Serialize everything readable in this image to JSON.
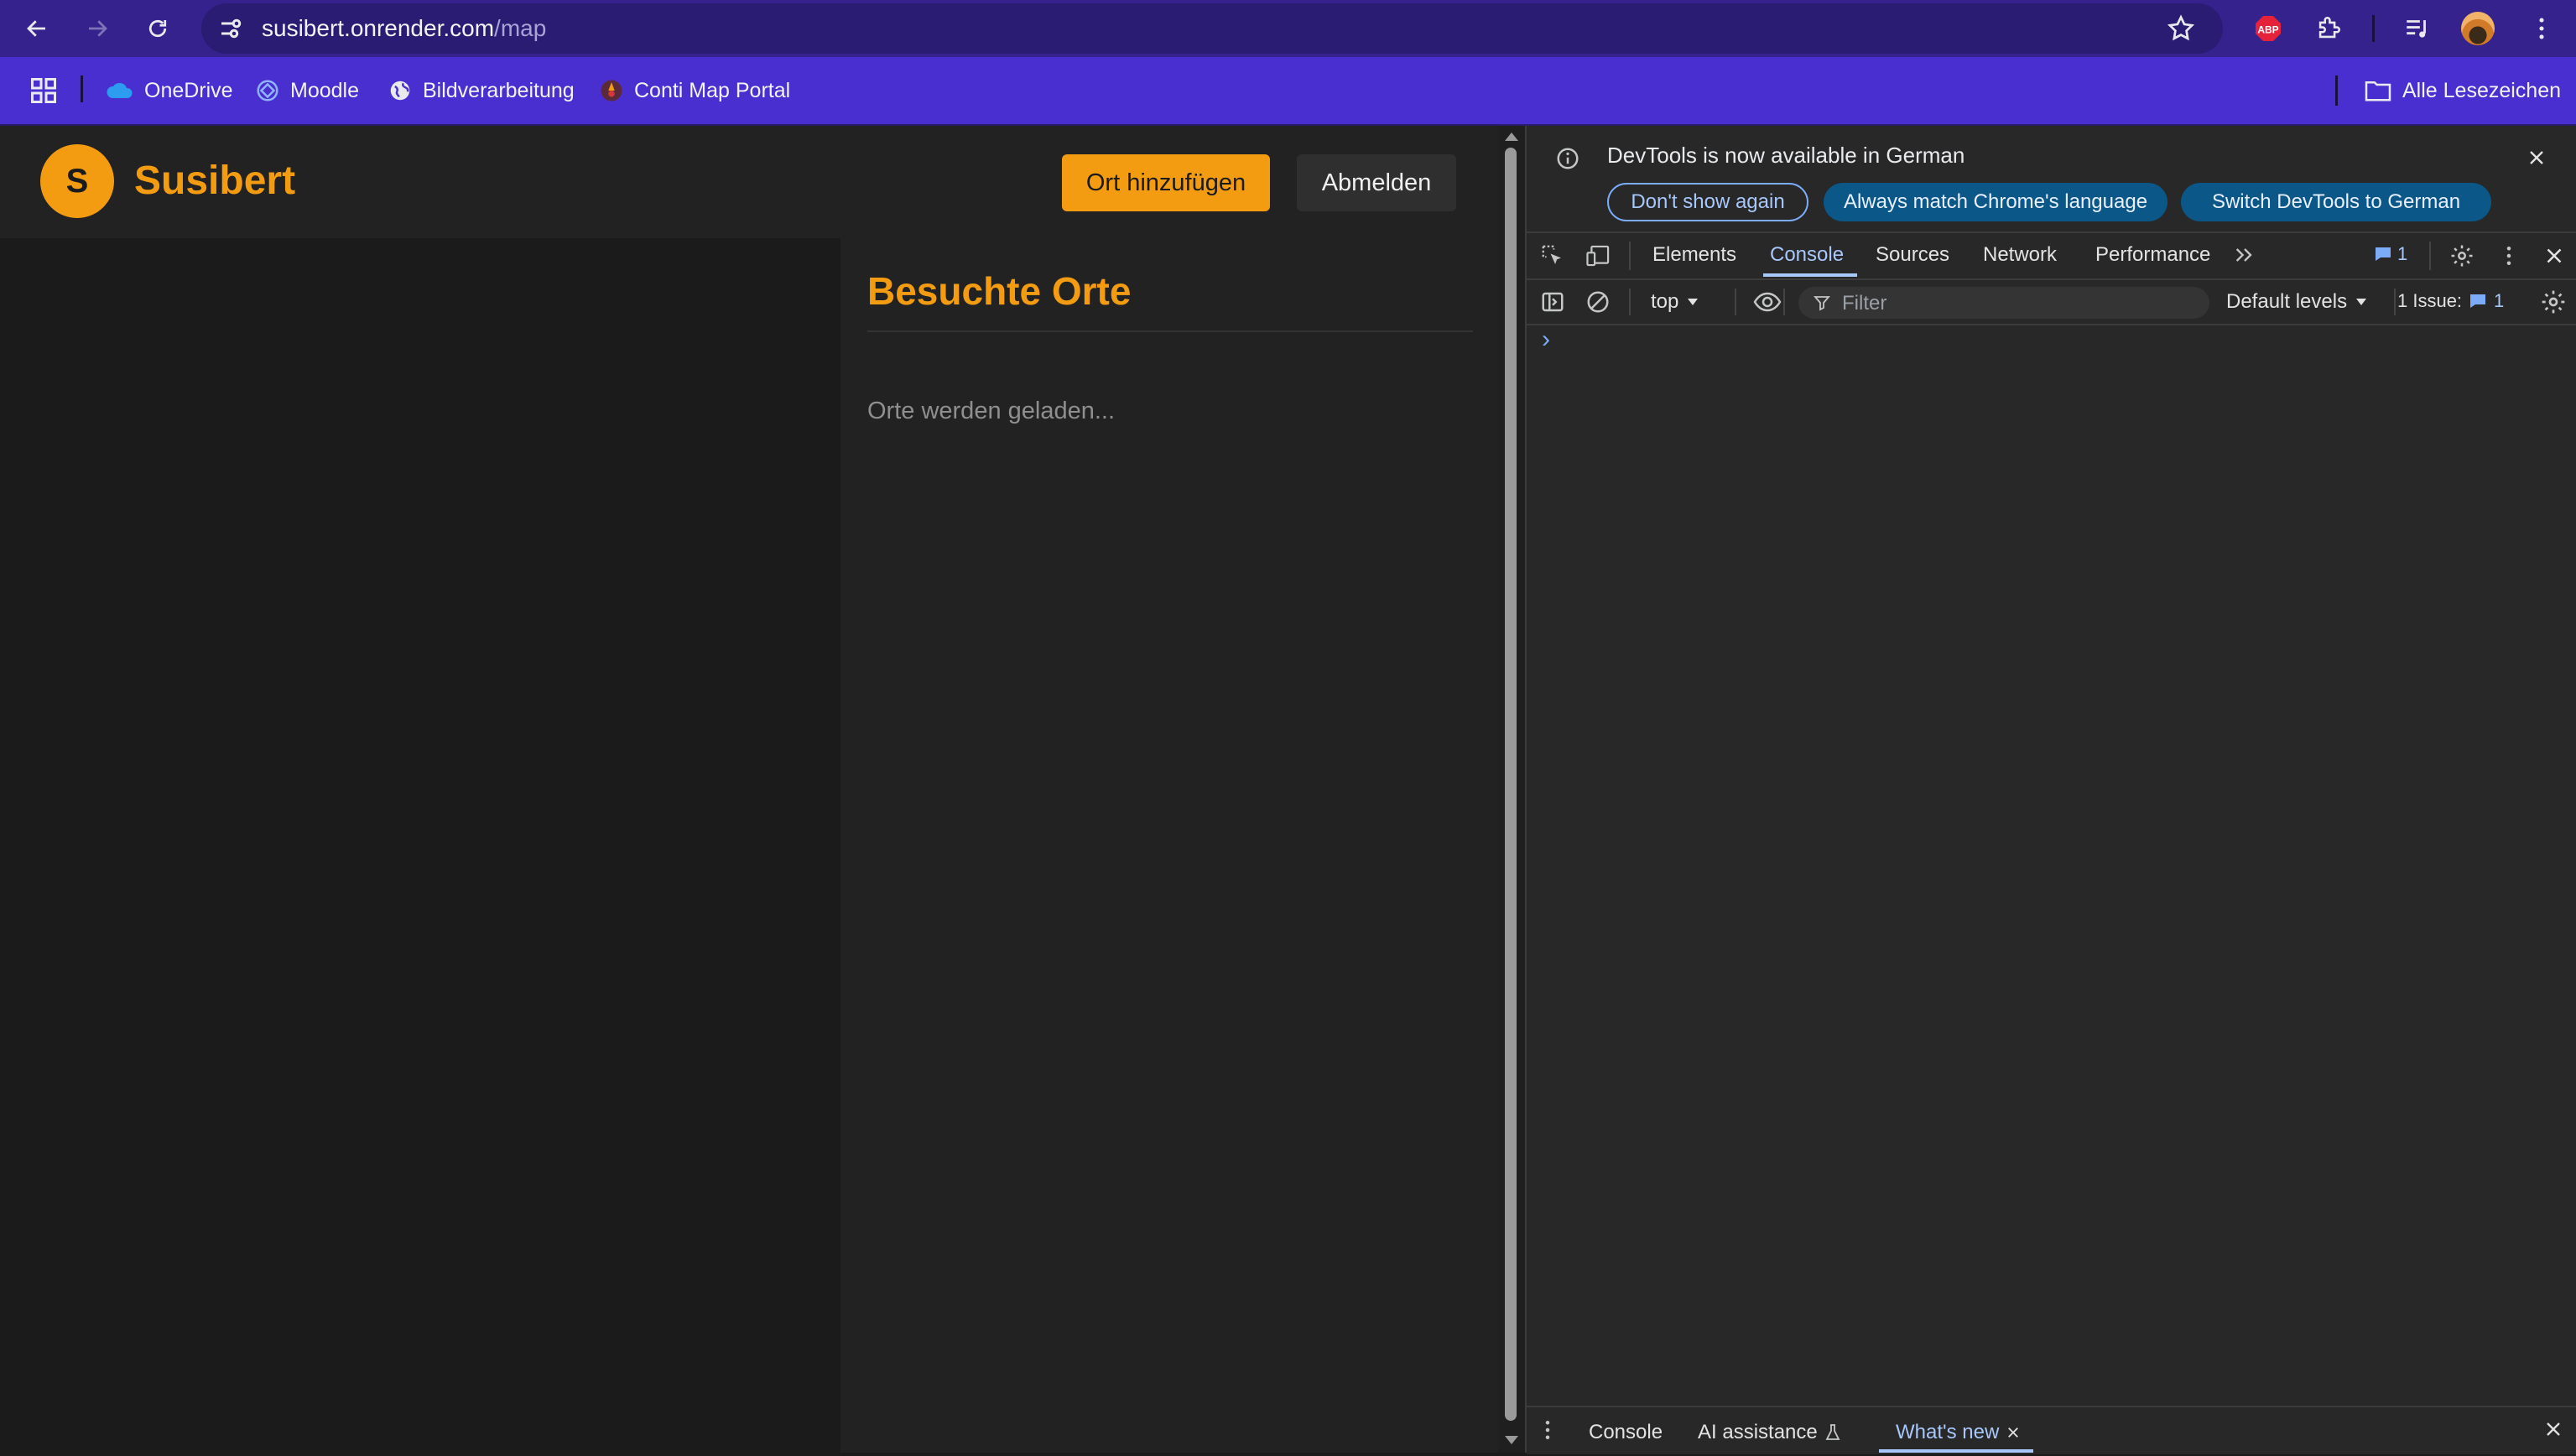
{
  "browser": {
    "url_host": "susibert.onrender.com",
    "url_path": "/map",
    "bookmarks": [
      {
        "label": "OneDrive",
        "icon": "onedrive-cloud-icon"
      },
      {
        "label": "Moodle",
        "icon": "moodle-icon"
      },
      {
        "label": "Bildverarbeitung",
        "icon": "globe-icon"
      },
      {
        "label": "Conti Map Portal",
        "icon": "conti-map-icon"
      }
    ],
    "all_bookmarks_label": "Alle Lesezeichen",
    "extension_badge": "ABP"
  },
  "app": {
    "logo_letter": "S",
    "brand": "Susibert",
    "add_place_label": "Ort hinzufügen",
    "logout_label": "Abmelden",
    "panel_title": "Besuchte Orte",
    "loading_text": "Orte werden geladen...",
    "accent_color": "#f39c12"
  },
  "devtools": {
    "info_text": "DevTools is now available in German",
    "info_buttons": [
      "Don't show again",
      "Always match Chrome's language",
      "Switch DevTools to German"
    ],
    "tabs": [
      "Elements",
      "Console",
      "Sources",
      "Network",
      "Performance"
    ],
    "active_tab": "Console",
    "message_count": "1",
    "context": "top",
    "filter_placeholder": "Filter",
    "levels": "Default levels",
    "issues_label": "1 Issue:",
    "issues_count": "1",
    "prompt": "›",
    "drawer_tabs": [
      "Console",
      "AI assistance",
      "What's new"
    ]
  }
}
